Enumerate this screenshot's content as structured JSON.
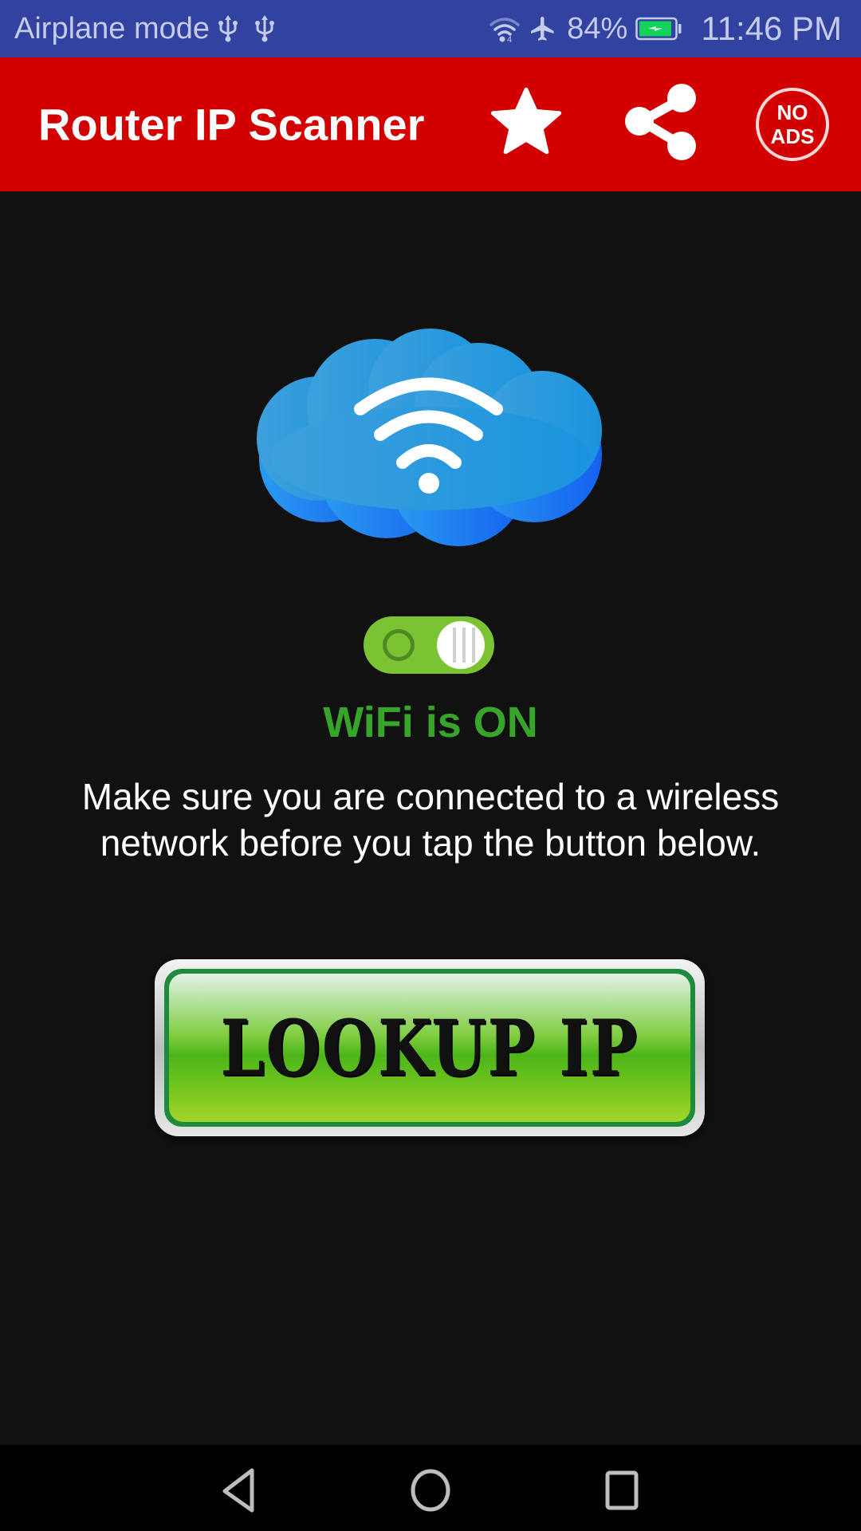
{
  "status_bar": {
    "mode_label": "Airplane mode",
    "left_icons": [
      "usb-icon",
      "usb-icon"
    ],
    "right_icons": [
      "wifi-signal-icon",
      "airplane-icon"
    ],
    "battery_percent": "84%",
    "battery_charging": true,
    "time": "11:46 PM"
  },
  "app_bar": {
    "title": "Router IP Scanner",
    "actions": [
      {
        "name": "rate",
        "icon": "star-icon"
      },
      {
        "name": "share",
        "icon": "share-icon"
      },
      {
        "name": "no-ads",
        "line1": "NO",
        "line2": "ADS"
      }
    ],
    "color": "#d30000"
  },
  "main": {
    "hero_icon": "wifi-cloud-icon",
    "wifi_toggle_on": true,
    "wifi_status": "WiFi is ON",
    "wifi_status_color": "#37a52a",
    "instructions": "Make sure you are connected to a wireless network before you tap the button below.",
    "lookup_button": "LOOKUP IP"
  },
  "nav_bar": {
    "buttons": [
      "back",
      "home",
      "recents"
    ]
  }
}
